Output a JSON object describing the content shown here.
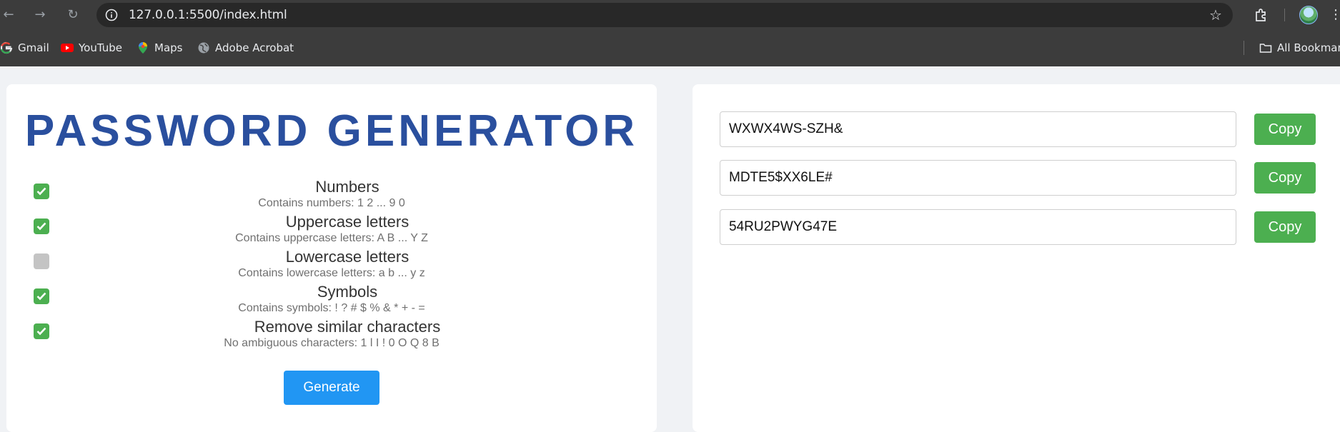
{
  "browser": {
    "url": "127.0.0.1:5500/index.html",
    "bookmarks": [
      "Gmail",
      "YouTube",
      "Maps",
      "Adobe Acrobat"
    ],
    "all_bookmarks": "All Bookmarks"
  },
  "app": {
    "title": "PASSWORD GENERATOR",
    "options": [
      {
        "label": "Numbers",
        "description": "Contains numbers: 1 2 ... 9 0",
        "checked": true
      },
      {
        "label": "Uppercase letters",
        "description": "Contains uppercase letters: A B ... Y Z",
        "checked": true
      },
      {
        "label": "Lowercase letters",
        "description": "Contains lowercase letters: a b ... y z",
        "checked": false
      },
      {
        "label": "Symbols",
        "description": "Contains symbols: ! ? # $ % & * + - =",
        "checked": true
      },
      {
        "label": "Remove similar characters",
        "description": "No ambiguous characters: 1 l I ! 0 O Q 8 B",
        "checked": true
      }
    ],
    "generate_label": "Generate",
    "passwords": [
      "WXWX4WS-SZH&",
      "MDTE5$XX6LE#",
      "54RU2PWYG47E"
    ],
    "copy_label": "Copy"
  },
  "colors": {
    "title": "#2a4f9e",
    "checkbox_checked": "#4caf50",
    "checkbox_unchecked": "#c4c4c4",
    "generate_button": "#2196f3",
    "copy_button": "#4caf50"
  }
}
